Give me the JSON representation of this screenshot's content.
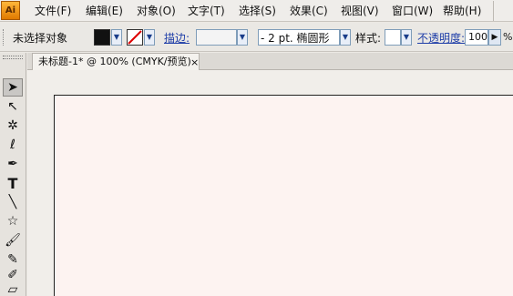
{
  "app": {
    "logo_text": "Ai"
  },
  "menu": {
    "items": [
      "文件(F)",
      "编辑(E)",
      "对象(O)",
      "文字(T)",
      "选择(S)",
      "效果(C)",
      "视图(V)",
      "窗口(W)",
      "帮助(H)"
    ]
  },
  "control": {
    "selection_label": "未选择对象",
    "fill_color": "#111111",
    "stroke_label": "描边:",
    "stroke_width": "- 2 pt. 椭圆形",
    "style_label": "样式:",
    "opacity_label": "不透明度:",
    "opacity_value": "100",
    "percent": "%"
  },
  "document": {
    "tab_title": "未标题-1* @ 100% (CMYK/预览)",
    "close_glyph": "×"
  },
  "tools": [
    {
      "name": "selection-tool-icon",
      "glyph": "➤"
    },
    {
      "name": "direct-selection-tool-icon",
      "glyph": "↖"
    },
    {
      "name": "magic-wand-tool-icon",
      "glyph": "✲"
    },
    {
      "name": "lasso-tool-icon",
      "glyph": "ℓ"
    },
    {
      "name": "pen-tool-icon",
      "glyph": "✒"
    },
    {
      "name": "type-tool-icon",
      "glyph": "T"
    },
    {
      "name": "line-tool-icon",
      "glyph": "╲"
    },
    {
      "name": "star-tool-icon",
      "glyph": "☆"
    },
    {
      "name": "paintbrush-tool-icon",
      "glyph": "🖌"
    },
    {
      "name": "pencil-tool-icon",
      "glyph": "✎"
    },
    {
      "name": "blob-brush-tool-icon",
      "glyph": "✐"
    },
    {
      "name": "eraser-tool-icon",
      "glyph": "▱"
    }
  ]
}
